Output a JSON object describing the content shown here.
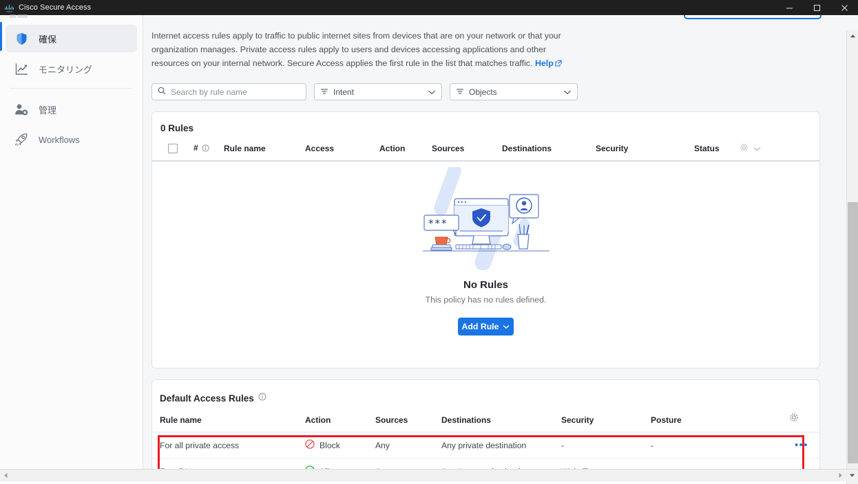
{
  "titlebar": {
    "app_title": "Cisco Secure Access",
    "logo_name": "cisco-logo",
    "brand_text": "cisco",
    "minimize_label": "Minimize",
    "maximize_label": "Maximize",
    "close_label": "Close"
  },
  "sidebar": {
    "items": [
      {
        "label": "確保",
        "icon": "shield-icon",
        "active": true
      },
      {
        "label": "モニタリング",
        "icon": "chart-line-icon",
        "active": false
      },
      {
        "label": "管理",
        "icon": "user-gear-icon",
        "active": false
      },
      {
        "label": "Workflows",
        "icon": "rocket-icon",
        "active": false
      }
    ]
  },
  "main": {
    "intro_text_1": "Internet access rules apply to traffic to public internet sites from devices that are on your network or that your organization manages. Private access rules apply to users and devices accessing applications and other resources on your internal network. Secure Access applies the first rule in the list that matches traffic.",
    "help_label": "Help"
  },
  "filters": {
    "search_placeholder": "Search by rule name",
    "search_value": "",
    "intent_label": "Intent",
    "objects_label": "Objects"
  },
  "rules_card": {
    "title": "0 Rules",
    "columns": [
      "#",
      "Rule name",
      "Access",
      "Action",
      "Sources",
      "Destinations",
      "Security",
      "Status"
    ],
    "empty_title": "No Rules",
    "empty_subtitle": "This policy has no rules defined.",
    "add_rule_label": "Add Rule"
  },
  "default_rules": {
    "title": "Default Access Rules",
    "columns": [
      "Rule name",
      "Action",
      "Sources",
      "Destinations",
      "Security",
      "Posture"
    ],
    "rows": [
      {
        "rule_name": "For all private access",
        "action": "Block",
        "action_icon": "block-icon",
        "sources": "Any",
        "destinations": "Any private destination",
        "security": "-",
        "posture": "-",
        "menu": "•••"
      },
      {
        "rule_name": "For all Internet access",
        "action": "Allow",
        "action_icon": "allow-icon",
        "sources": "Any",
        "destinations": "Any Internet destination",
        "security": "Web, Tenant",
        "posture": "-",
        "menu": "•••"
      }
    ]
  },
  "colors": {
    "accent_blue": "#1b74e4",
    "highlight_red": "#ec1c24",
    "block_red": "#e8524f",
    "allow_green": "#3aaa35",
    "titlebar_bg": "#1f1f1f"
  }
}
